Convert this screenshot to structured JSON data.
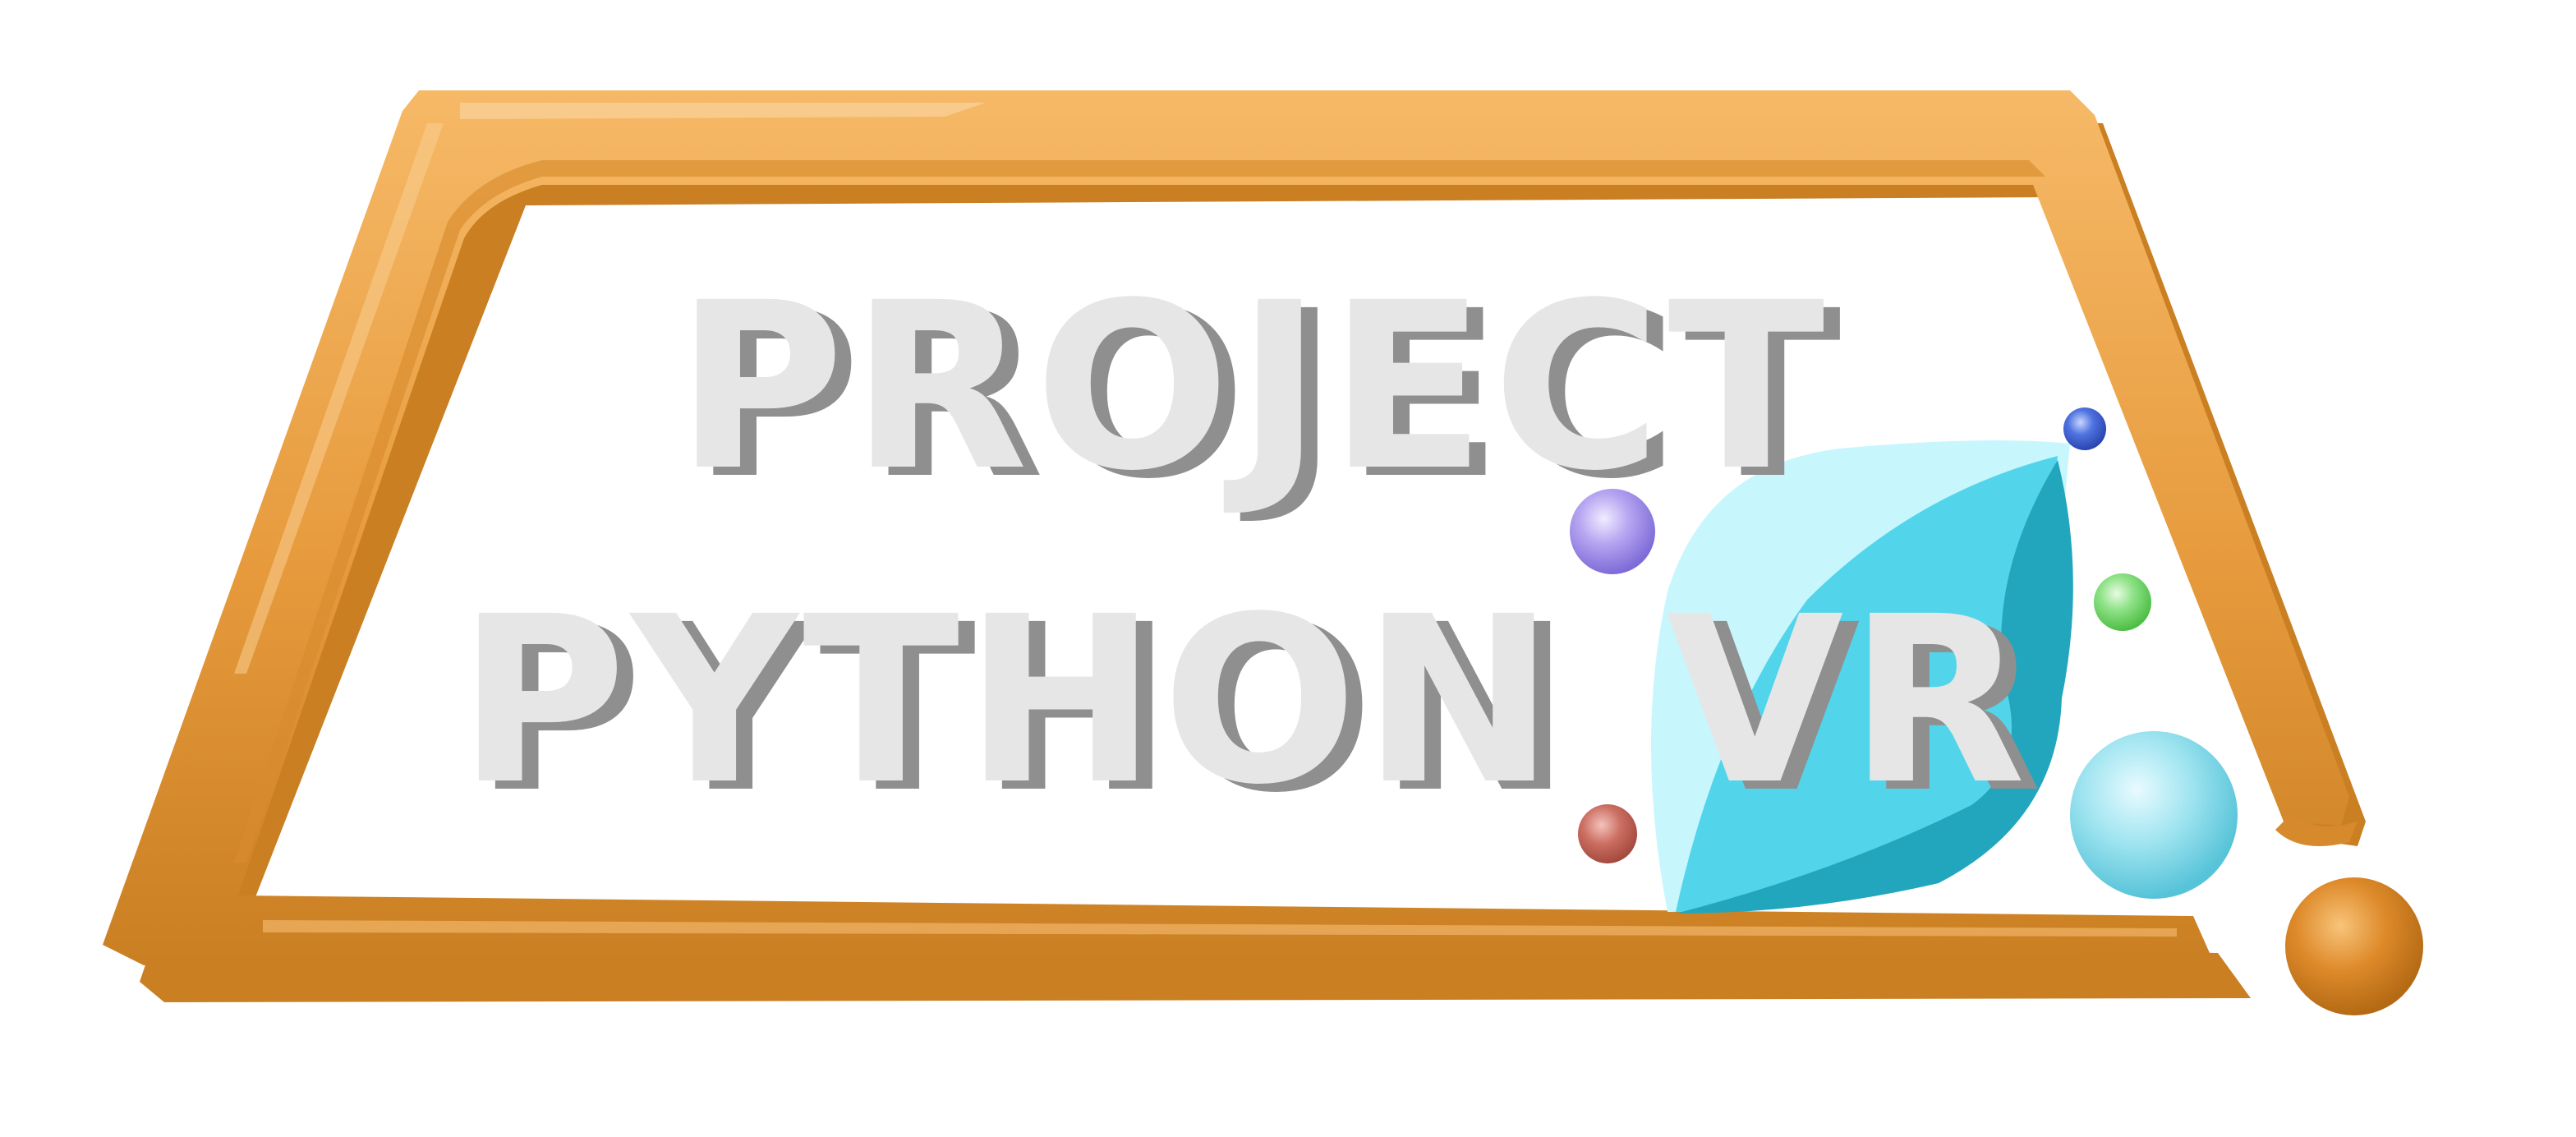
{
  "logo": {
    "line1": "PROJECT",
    "line2_word1": "PYTHON",
    "line2_word2": "VR"
  },
  "colors": {
    "frame_light": "#F2AD55",
    "frame_mid": "#E69A3C",
    "frame_dark": "#C97F22",
    "text_face": "#E6E6E6",
    "text_shadow": "#8F8F8F",
    "leaf_light": "#C8F6FD",
    "leaf_mid": "#52D5EB",
    "leaf_dark": "#22A6BE",
    "orb_blue": "#3E63D3",
    "orb_purple": "#9C8AE6",
    "orb_green": "#78DB6E",
    "orb_cyan": "#8FE0EE",
    "orb_red": "#C7665A",
    "orb_orange": "#D88423"
  },
  "icons": [
    "leaf-icon",
    "orb-icons",
    "frame-shape"
  ]
}
